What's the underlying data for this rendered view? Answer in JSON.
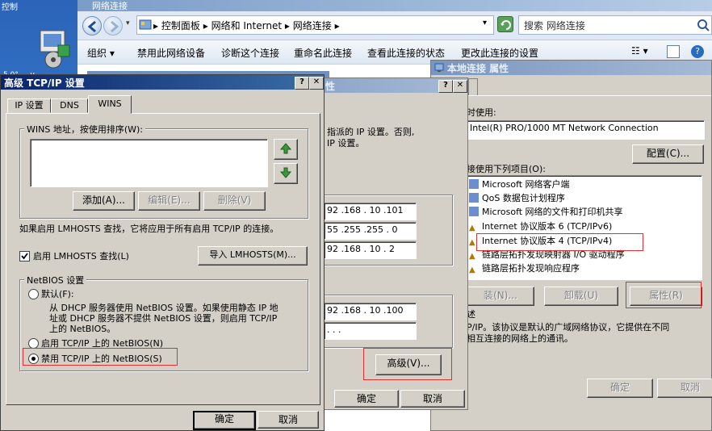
{
  "desktop": {
    "top_left_text": "控制",
    "bottom_icon_text": "5 0°  - . v -"
  },
  "explorer": {
    "title": "网络连接",
    "address": {
      "segments": [
        "控制面板",
        "网络和 Internet",
        "网络连接"
      ],
      "separator": "▸"
    },
    "search_placeholder": "搜索 网络连接",
    "commands": [
      "组织 ▾",
      "禁用此网络设备",
      "诊断这个连接",
      "重命名此连接",
      "查看此连接的状态",
      "更改此连接的设置"
    ]
  },
  "props_dialog": {
    "title": "本地连接 属性",
    "connect_using_label": "时使用:",
    "adapter": "Intel(R) PRO/1000 MT Network Connection",
    "configure_button": "配置(C)...",
    "items_label": "接使用下列项目(O):",
    "items": [
      "Microsoft 网络客户端",
      "QoS 数据包计划程序",
      "Microsoft 网络的文件和打印机共享",
      "Internet 协议版本 6 (TCP/IPv6)",
      "Internet 协议版本 4 (TCP/IPv4)",
      "链路层拓扑发现映射器 I/O 驱动程序",
      "链路层拓扑发现响应程序"
    ],
    "install_button": "装(N)...",
    "uninstall_button": "卸载(U)",
    "properties_button": "属性(R)",
    "description_label": "述",
    "description_line1": "P/IP。该协议是默认的广域网络协议，它提供在不同",
    "description_line2": "相互连接的网络上的通讯。",
    "ok_button": "确定",
    "cancel_button": "取消"
  },
  "ipv4_dialog": {
    "title": "性",
    "text_line1": "指派的 IP 设置。否则,",
    "text_line2": "IP 设置。",
    "ip_address": "92 .168 . 10 .101",
    "subnet_mask": "55 .255 .255 . 0",
    "gateway": "92 .168 . 10 . 2",
    "dns_primary": "92 .168 . 10 .100",
    "dns_secondary": ". . .",
    "advanced_button": "高级(V)...",
    "ok_button": "确定",
    "cancel_button": "取消"
  },
  "advanced_dialog": {
    "title": "高级 TCP/IP 设置",
    "tabs": [
      "IP 设置",
      "DNS",
      "WINS"
    ],
    "active_tab": "WINS",
    "wins_group_label": "WINS 地址，按使用排序(W):",
    "add_button": "添加(A)...",
    "edit_button": "编辑(E)...",
    "delete_button": "删除(V)",
    "lmhosts_text": "如果启用 LMHOSTS 查找，它将应用于所有启用 TCP/IP 的连接。",
    "lmhosts_checkbox": "启用 LMHOSTS 查找(L)",
    "lmhosts_checked": true,
    "import_button": "导入 LMHOSTS(M)...",
    "netbios_group": "NetBIOS 设置",
    "radio_default": "默认(F):",
    "default_desc_line1": "从 DHCP 服务器使用 NetBIOS 设置。如果使用静态 IP 地",
    "default_desc_line2": "址或 DHCP 服务器不提供 NetBIOS 设置，则启用 TCP/IP",
    "default_desc_line3": "上的 NetBIOS。",
    "radio_enable": "启用 TCP/IP 上的 NetBIOS(N)",
    "radio_disable": "禁用 TCP/IP 上的 NetBIOS(S)",
    "selected_radio": "disable",
    "ok_button": "确定",
    "cancel_button": "取消"
  },
  "colors": {
    "dialog_bg": "#d4d0c8",
    "title_active": "#0a246a",
    "highlight_red": "#e03030"
  }
}
